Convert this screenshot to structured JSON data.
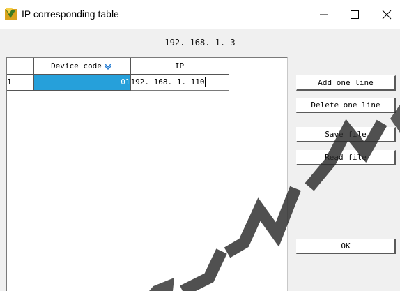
{
  "window": {
    "title": "IP corresponding table",
    "minimize_glyph": "—",
    "maximize_glyph": "☐",
    "close_glyph": "✕"
  },
  "header": {
    "ip_address": "192. 168. 1. 3"
  },
  "table": {
    "columns": [
      "",
      "Device code",
      "IP"
    ],
    "rows": [
      {
        "row_number": "1",
        "device_code": "01",
        "ip": "192. 168. 1. 110"
      }
    ]
  },
  "buttons": {
    "add_line": "Add one line",
    "delete_line": "Delete one line",
    "save_file": "Save file",
    "read_file": "Read file",
    "ok": "OK"
  },
  "colors": {
    "selection": "#26a0da",
    "watermark": "#2a2a2a"
  }
}
